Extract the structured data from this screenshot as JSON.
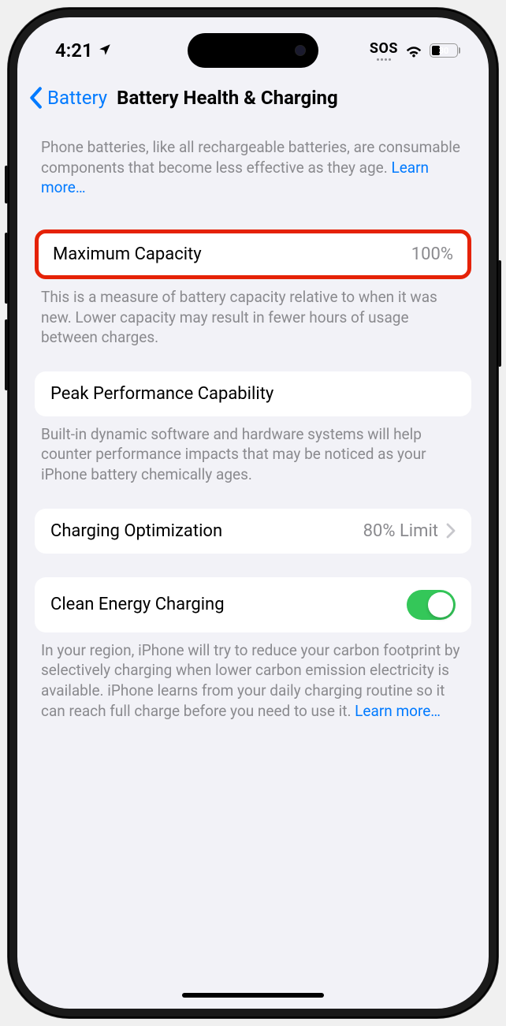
{
  "status": {
    "time": "4:21",
    "sos": "SOS",
    "battery_percent": "30"
  },
  "nav": {
    "back_label": "Battery",
    "title": "Battery Health & Charging"
  },
  "intro": {
    "text": "Phone batteries, like all rechargeable batteries, are consumable components that become less effective as they age. ",
    "learn_more": "Learn more…"
  },
  "max_capacity": {
    "label": "Maximum Capacity",
    "value": "100%",
    "footer": "This is a measure of battery capacity relative to when it was new. Lower capacity may result in fewer hours of usage between charges."
  },
  "peak_performance": {
    "label": "Peak Performance Capability",
    "footer": "Built-in dynamic software and hardware systems will help counter performance impacts that may be noticed as your iPhone battery chemically ages."
  },
  "charging_optimization": {
    "label": "Charging Optimization",
    "value": "80% Limit"
  },
  "clean_energy": {
    "label": "Clean Energy Charging",
    "footer": "In your region, iPhone will try to reduce your carbon footprint by selectively charging when lower carbon emission electricity is available. iPhone learns from your daily charging routine so it can reach full charge before you need to use it. ",
    "learn_more": "Learn more…"
  }
}
